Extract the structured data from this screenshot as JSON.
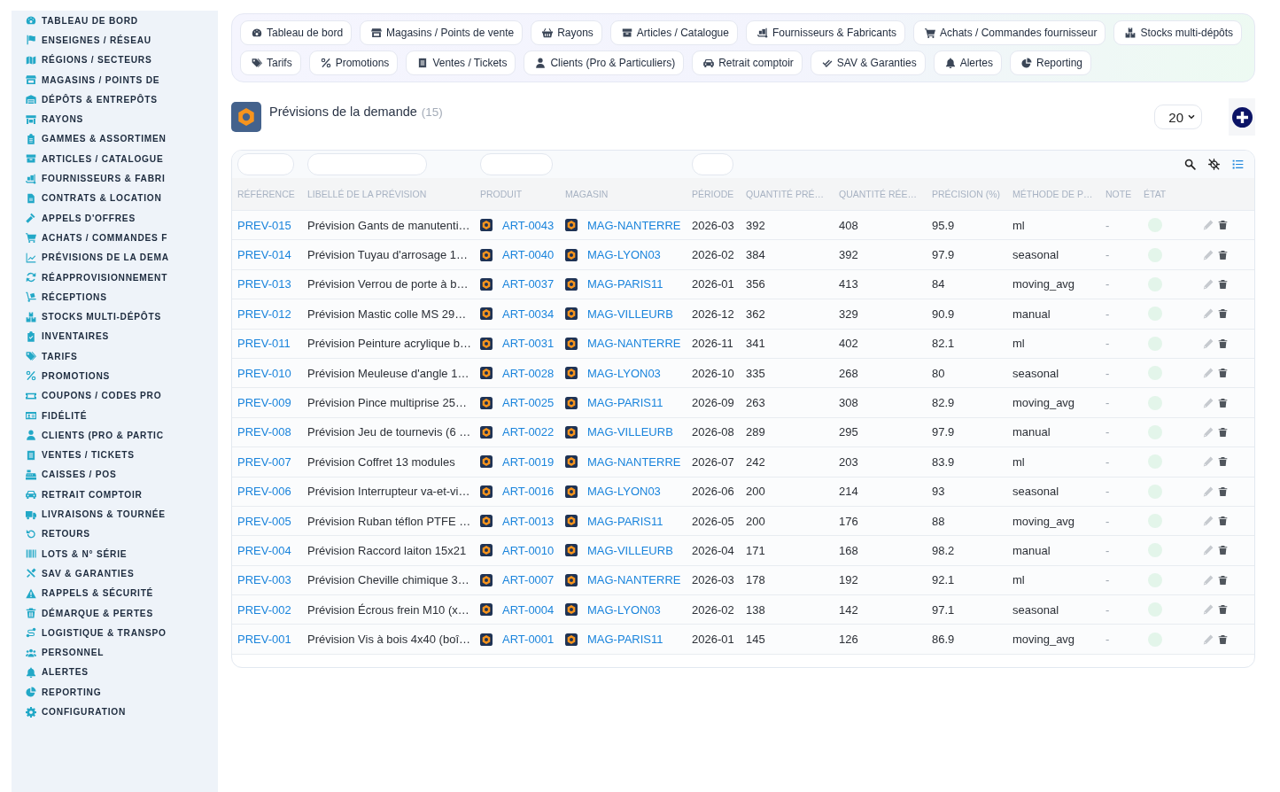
{
  "sidebar": {
    "items": [
      "TABLEAU DE BORD",
      "ENSEIGNES / RÉSEAU",
      "RÉGIONS / SECTEURS",
      "MAGASINS / POINTS DE",
      "DÉPÔTS & ENTREPÔTS",
      "RAYONS",
      "GAMMES & ASSORTIMEN",
      "ARTICLES / CATALOGUE",
      "FOURNISSEURS & FABRI",
      "CONTRATS & LOCATION",
      "APPELS D'OFFRES",
      "ACHATS / COMMANDES F",
      "PRÉVISIONS DE LA DEMA",
      "RÉAPPROVISIONNEMENT",
      "RÉCEPTIONS",
      "STOCKS MULTI-DÉPÔTS",
      "INVENTAIRES",
      "TARIFS",
      "PROMOTIONS",
      "COUPONS / CODES PRO",
      "FIDÉLITÉ",
      "CLIENTS (PRO & PARTIC",
      "VENTES / TICKETS",
      "CAISSES / POS",
      "RETRAIT COMPTOIR",
      "LIVRAISONS & TOURNÉE",
      "RETOURS",
      "LOTS & N° SÉRIE",
      "SAV & GARANTIES",
      "RAPPELS & SÉCURITÉ",
      "DÉMARQUE & PERTES",
      "LOGISTIQUE & TRANSPO",
      "PERSONNEL",
      "ALERTES",
      "REPORTING",
      "CONFIGURATION"
    ]
  },
  "nav": {
    "items": [
      "Tableau de bord",
      "Magasins / Points de vente",
      "Rayons",
      "Articles / Catalogue",
      "Fournisseurs & Fabricants",
      "Achats / Commandes fournisseur",
      "Stocks multi-dépôts",
      "Tarifs",
      "Promotions",
      "Ventes / Tickets",
      "Clients (Pro & Particuliers)",
      "Retrait comptoir",
      "SAV & Garanties",
      "Alertes",
      "Reporting"
    ]
  },
  "page": {
    "title": "Prévisions de la demande",
    "count": "(15)",
    "page_size": "20"
  },
  "table": {
    "columns": [
      {
        "label": "RÉFÉRENCE",
        "filter": true
      },
      {
        "label": "LIBELLÉ DE LA PRÉVISION",
        "filter": true
      },
      {
        "label": "PRODUIT",
        "filter": true
      },
      {
        "label": "MAGASIN",
        "filter": false
      },
      {
        "label": "PÉRIODE",
        "filter": true
      },
      {
        "label": "QUANTITÉ PRÉ…",
        "filter": false
      },
      {
        "label": "QUANTITÉ RÉE…",
        "filter": false
      },
      {
        "label": "PRÉCISION (%)",
        "filter": false
      },
      {
        "label": "MÉTHODE DE P…",
        "filter": false
      },
      {
        "label": "NOTE",
        "filter": false
      },
      {
        "label": "ÉTAT",
        "filter": false
      }
    ],
    "rows": [
      {
        "reference": "PREV-015",
        "label": "Prévision Gants de manutenti…",
        "product": "ART-0043",
        "store": "MAG-NANTERRE",
        "period": "2026-03",
        "quantity_forecast": "392",
        "quantity_actual": "408",
        "accuracy": "95.9",
        "method": "ml",
        "note": "-",
        "color": "#e3f5ea"
      },
      {
        "reference": "PREV-014",
        "label": "Prévision Tuyau d'arrosage 1…",
        "product": "ART-0040",
        "store": "MAG-LYON03",
        "period": "2026-02",
        "quantity_forecast": "384",
        "quantity_actual": "392",
        "accuracy": "97.9",
        "method": "seasonal",
        "note": "-",
        "color": "#e3f5ea"
      },
      {
        "reference": "PREV-013",
        "label": "Prévision Verrou de porte à b…",
        "product": "ART-0037",
        "store": "MAG-PARIS11",
        "period": "2026-01",
        "quantity_forecast": "356",
        "quantity_actual": "413",
        "accuracy": "84",
        "method": "moving_avg",
        "note": "-",
        "color": "#e3f5ea"
      },
      {
        "reference": "PREV-012",
        "label": "Prévision Mastic colle MS 29…",
        "product": "ART-0034",
        "store": "MAG-VILLEURB",
        "period": "2026-12",
        "quantity_forecast": "362",
        "quantity_actual": "329",
        "accuracy": "90.9",
        "method": "manual",
        "note": "-",
        "color": "#e3f5ea"
      },
      {
        "reference": "PREV-011",
        "label": "Prévision Peinture acrylique b…",
        "product": "ART-0031",
        "store": "MAG-NANTERRE",
        "period": "2026-11",
        "quantity_forecast": "341",
        "quantity_actual": "402",
        "accuracy": "82.1",
        "method": "ml",
        "note": "-",
        "color": "#e3f5ea"
      },
      {
        "reference": "PREV-010",
        "label": "Prévision Meuleuse d'angle 1…",
        "product": "ART-0028",
        "store": "MAG-LYON03",
        "period": "2026-10",
        "quantity_forecast": "335",
        "quantity_actual": "268",
        "accuracy": "80",
        "method": "seasonal",
        "note": "-",
        "color": "#e3f5ea"
      },
      {
        "reference": "PREV-009",
        "label": "Prévision Pince multiprise 25…",
        "product": "ART-0025",
        "store": "MAG-PARIS11",
        "period": "2026-09",
        "quantity_forecast": "263",
        "quantity_actual": "308",
        "accuracy": "82.9",
        "method": "moving_avg",
        "note": "-",
        "color": "#e3f5ea"
      },
      {
        "reference": "PREV-008",
        "label": "Prévision Jeu de tournevis (6 …",
        "product": "ART-0022",
        "store": "MAG-VILLEURB",
        "period": "2026-08",
        "quantity_forecast": "289",
        "quantity_actual": "295",
        "accuracy": "97.9",
        "method": "manual",
        "note": "-",
        "color": "#e3f5ea"
      },
      {
        "reference": "PREV-007",
        "label": "Prévision Coffret 13 modules",
        "product": "ART-0019",
        "store": "MAG-NANTERRE",
        "period": "2026-07",
        "quantity_forecast": "242",
        "quantity_actual": "203",
        "accuracy": "83.9",
        "method": "ml",
        "note": "-",
        "color": "#e3f5ea"
      },
      {
        "reference": "PREV-006",
        "label": "Prévision Interrupteur va-et-vi…",
        "product": "ART-0016",
        "store": "MAG-LYON03",
        "period": "2026-06",
        "quantity_forecast": "200",
        "quantity_actual": "214",
        "accuracy": "93",
        "method": "seasonal",
        "note": "-",
        "color": "#e3f5ea"
      },
      {
        "reference": "PREV-005",
        "label": "Prévision Ruban téflon PTFE …",
        "product": "ART-0013",
        "store": "MAG-PARIS11",
        "period": "2026-05",
        "quantity_forecast": "200",
        "quantity_actual": "176",
        "accuracy": "88",
        "method": "moving_avg",
        "note": "-",
        "color": "#e3f5ea"
      },
      {
        "reference": "PREV-004",
        "label": "Prévision Raccord laiton 15x21",
        "product": "ART-0010",
        "store": "MAG-VILLEURB",
        "period": "2026-04",
        "quantity_forecast": "171",
        "quantity_actual": "168",
        "accuracy": "98.2",
        "method": "manual",
        "note": "-",
        "color": "#e3f5ea"
      },
      {
        "reference": "PREV-003",
        "label": "Prévision Cheville chimique 3…",
        "product": "ART-0007",
        "store": "MAG-NANTERRE",
        "period": "2026-03",
        "quantity_forecast": "178",
        "quantity_actual": "192",
        "accuracy": "92.1",
        "method": "ml",
        "note": "-",
        "color": "#e3f5ea"
      },
      {
        "reference": "PREV-002",
        "label": "Prévision Écrous frein M10 (x…",
        "product": "ART-0004",
        "store": "MAG-LYON03",
        "period": "2026-02",
        "quantity_forecast": "138",
        "quantity_actual": "142",
        "accuracy": "97.1",
        "method": "seasonal",
        "note": "-",
        "color": "#e3f5ea"
      },
      {
        "reference": "PREV-001",
        "label": "Prévision Vis à bois 4x40 (boî…",
        "product": "ART-0001",
        "store": "MAG-PARIS11",
        "period": "2026-01",
        "quantity_forecast": "145",
        "quantity_actual": "126",
        "accuracy": "86.9",
        "method": "moving_avg",
        "note": "-",
        "color": "#e3f5ea"
      }
    ]
  }
}
